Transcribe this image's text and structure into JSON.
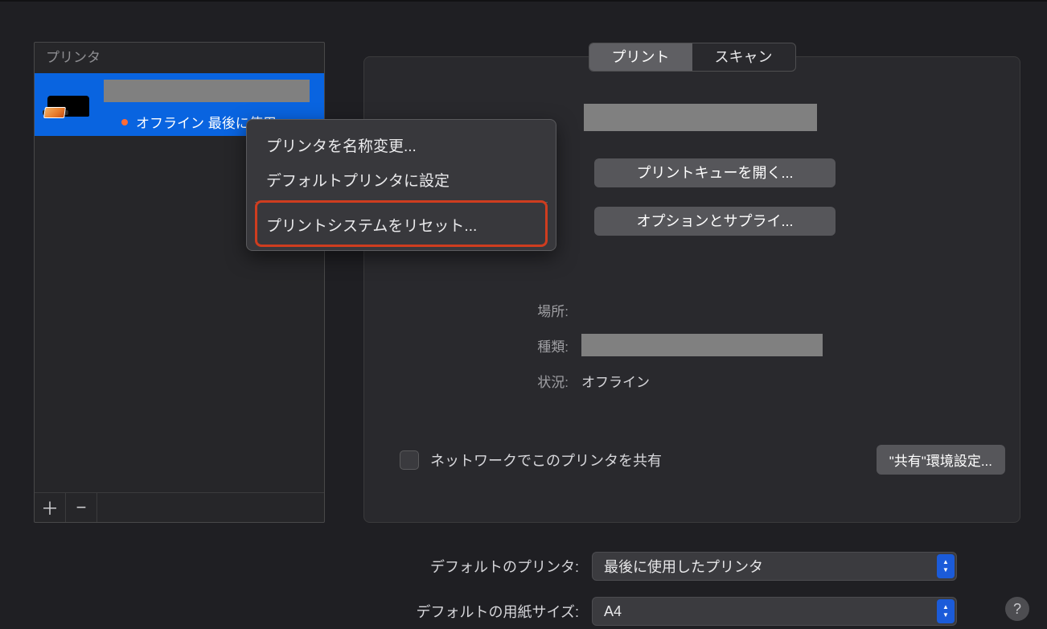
{
  "sidebar": {
    "header": "プリンタ",
    "printer": {
      "status_text": "オフライン 最後に使用"
    },
    "add_btn": "＋",
    "remove_btn": "−"
  },
  "context_menu": {
    "rename": "プリンタを名称変更...",
    "set_default": "デフォルトプリンタに設定",
    "reset": "プリントシステムをリセット..."
  },
  "tabs": {
    "print": "プリント",
    "scan": "スキャン"
  },
  "buttons": {
    "open_queue": "プリントキューを開く...",
    "options_supplies": "オプションとサプライ...",
    "sharing_prefs": "\"共有\"環境設定..."
  },
  "info": {
    "location_label": "場所:",
    "location_value": "",
    "type_label": "種類:",
    "status_label": "状況:",
    "status_value": "オフライン"
  },
  "sharing": {
    "label": "ネットワークでこのプリンタを共有"
  },
  "bottom": {
    "default_printer_label": "デフォルトのプリンタ:",
    "default_printer_value": "最後に使用したプリンタ",
    "paper_size_label": "デフォルトの用紙サイズ:",
    "paper_size_value": "A4"
  },
  "help": "?"
}
